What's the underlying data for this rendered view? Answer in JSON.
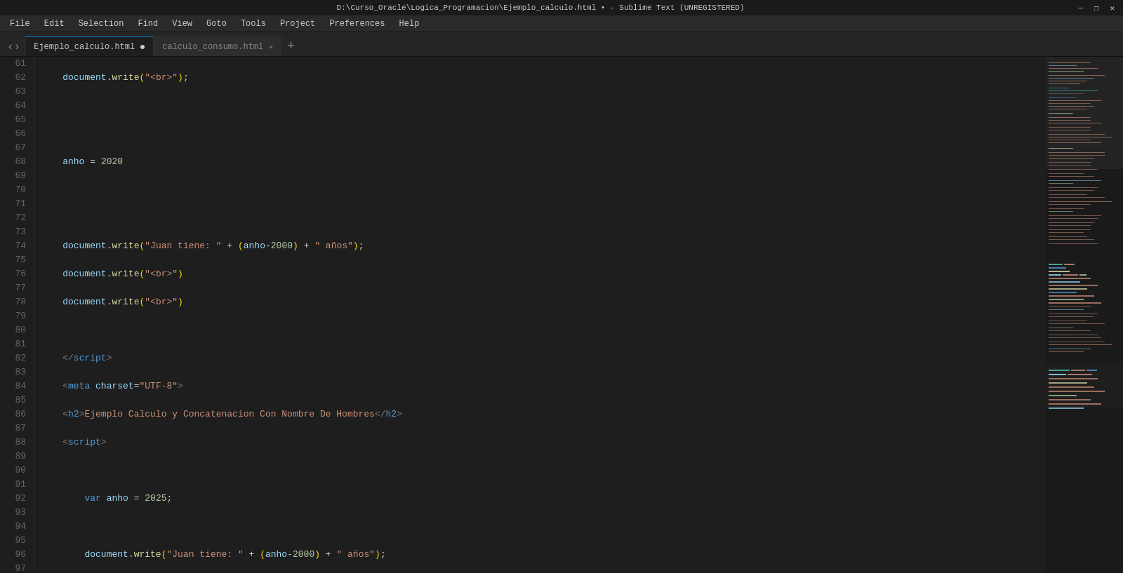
{
  "titleBar": {
    "text": "D:\\Curso_Oracle\\Logica_Programacion\\Ejemplo_calculo.html • - Sublime Text (UNREGISTERED)",
    "controls": [
      "—",
      "❐",
      "✕"
    ]
  },
  "menu": {
    "items": [
      "File",
      "Edit",
      "Selection",
      "Find",
      "View",
      "Goto",
      "Tools",
      "Project",
      "Preferences",
      "Help"
    ]
  },
  "tabs": [
    {
      "label": "Ejemplo_calculo.html",
      "active": true,
      "dot": true
    },
    {
      "label": "calculo_consumo.html",
      "active": false,
      "dot": false
    }
  ],
  "editor": {
    "startLine": 61
  },
  "minimap": {
    "visible": true
  }
}
